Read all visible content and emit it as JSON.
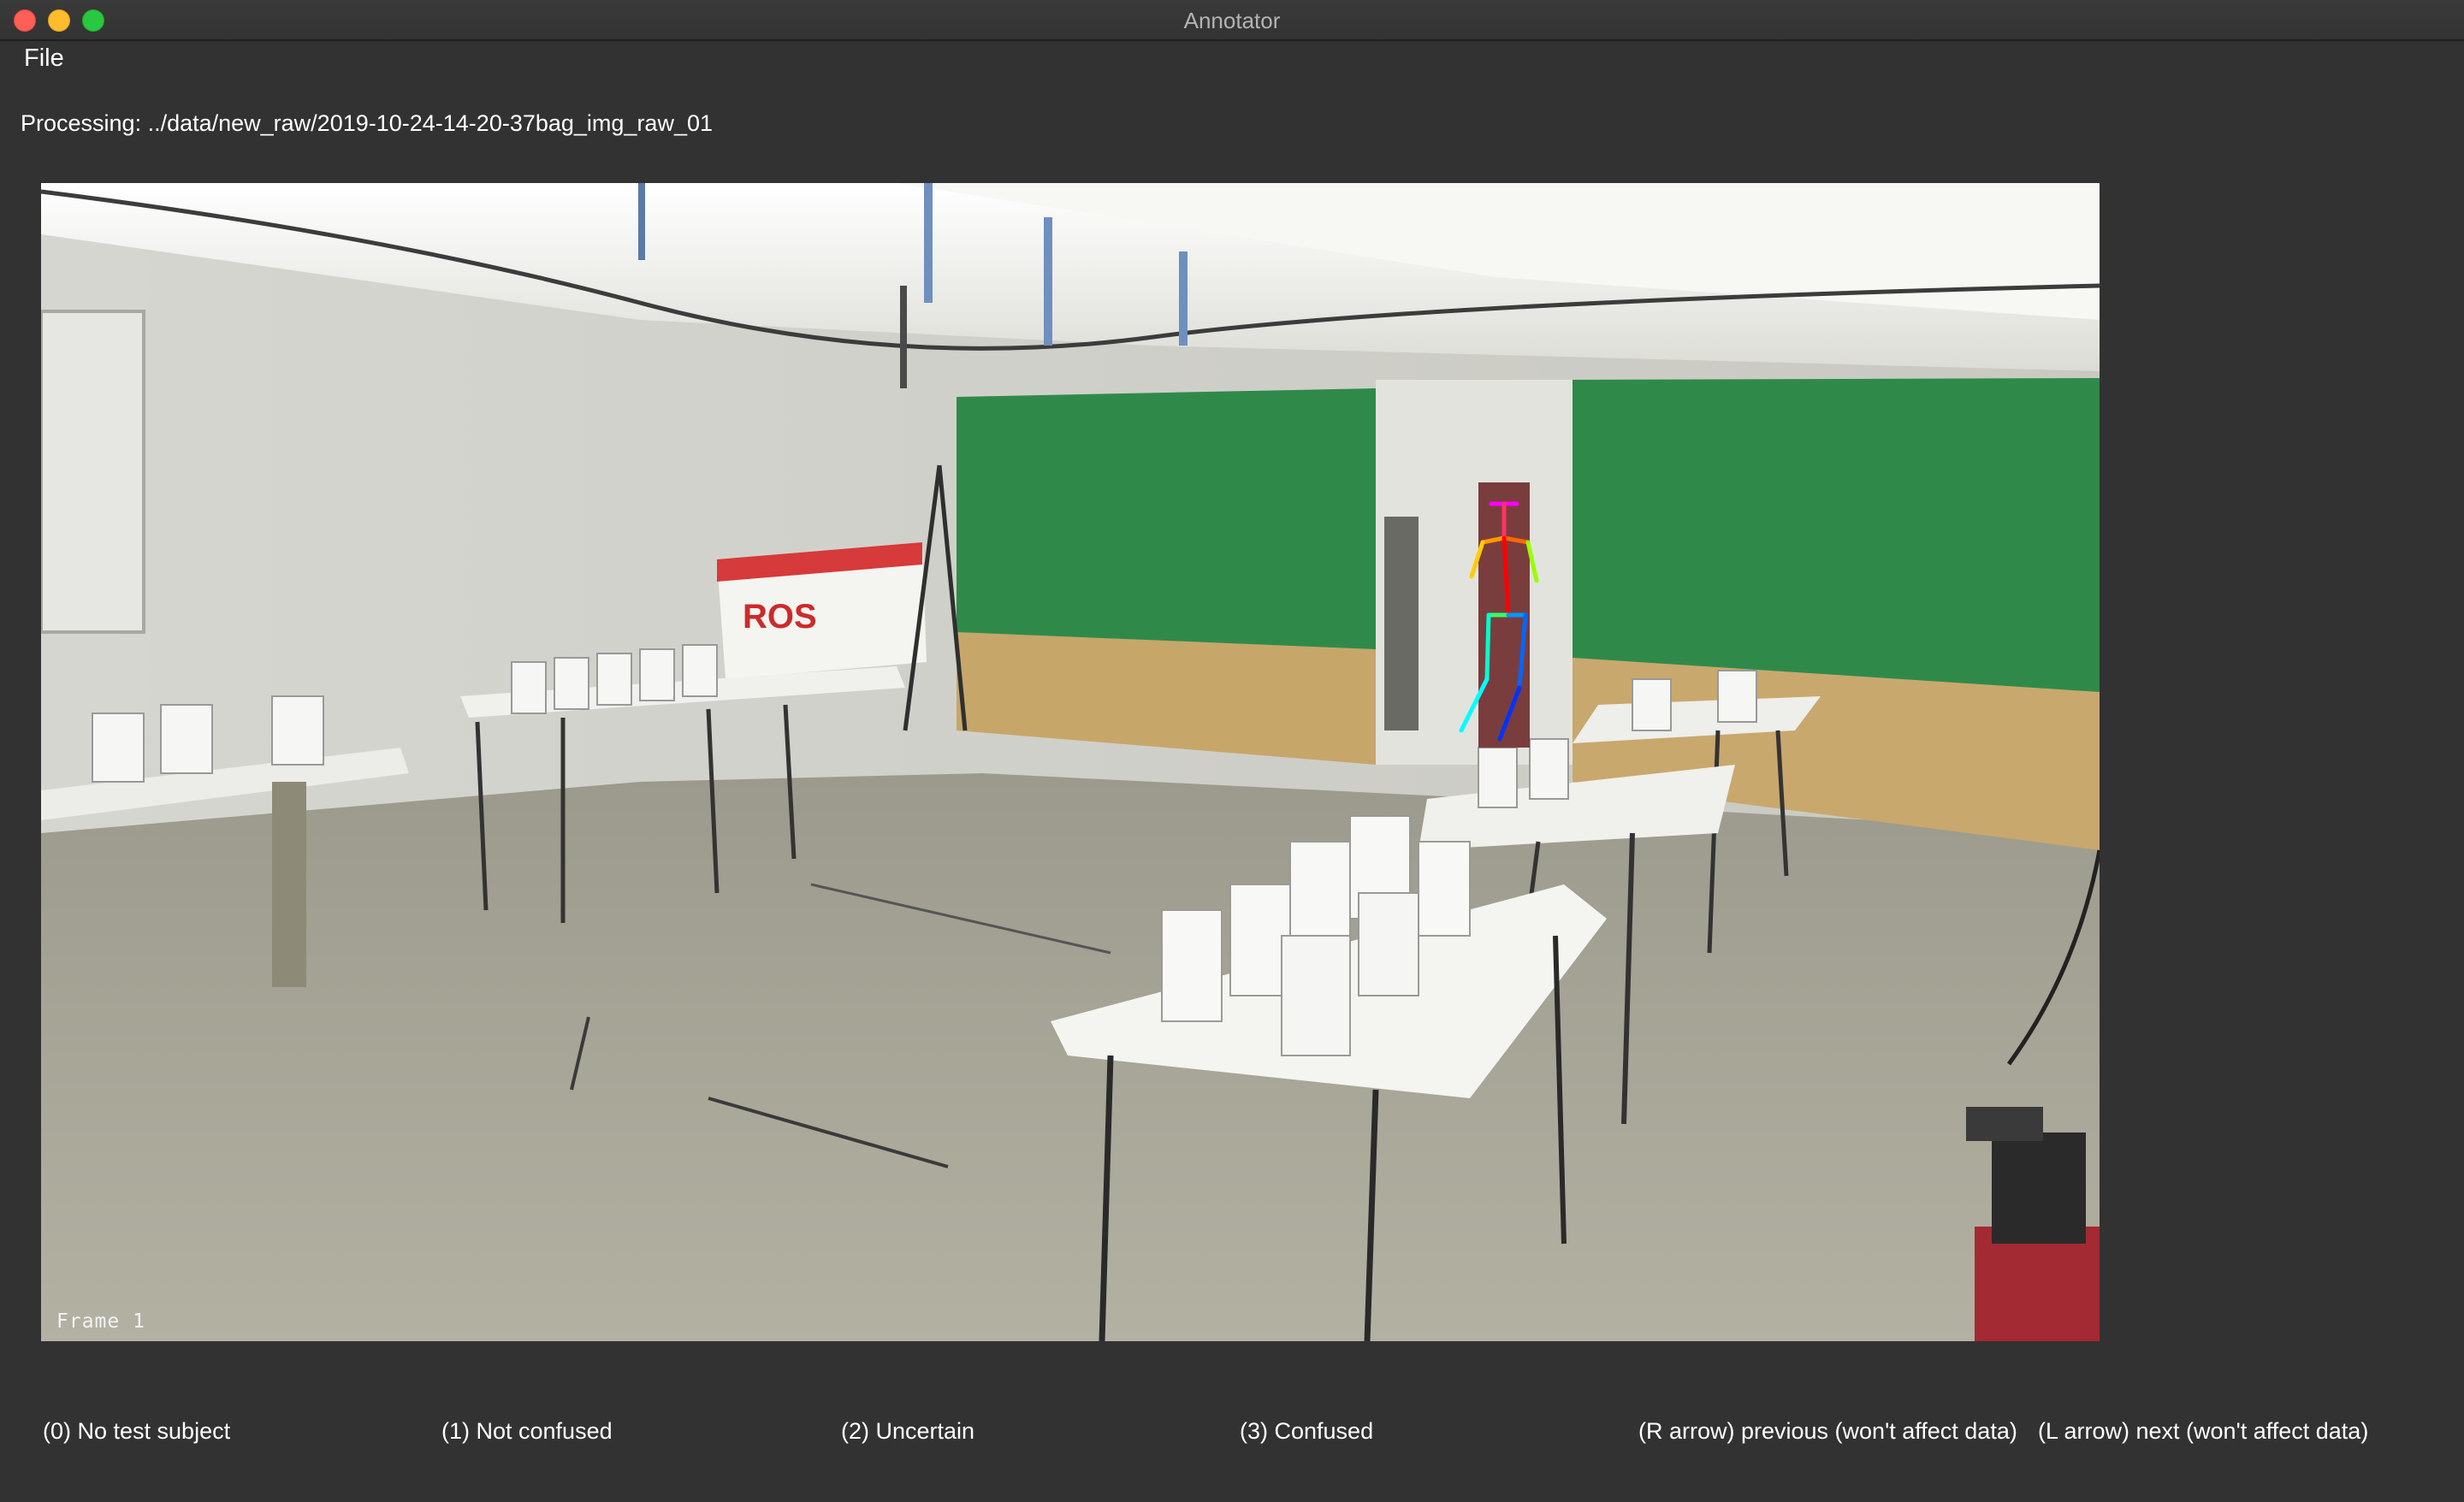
{
  "window": {
    "title": "Annotator"
  },
  "menu": {
    "file": "File"
  },
  "status": {
    "processing": "Processing: ../data/new_raw/2019-10-24-14-20-37bag_img_raw_01"
  },
  "viewer": {
    "frame_label": "Frame 1"
  },
  "buttons": {
    "no_subject": "(0) No test subject",
    "not_confused": "(1) Not confused",
    "uncertain": "(2) Uncertain",
    "confused": "(3) Confused",
    "previous": "(R arrow) previous (won't affect data)",
    "next": "(L arrow) next (won't affect data)"
  },
  "colors": {
    "background": "#323232",
    "text": "#ffffff",
    "green_screen": "#2f8a4a"
  }
}
